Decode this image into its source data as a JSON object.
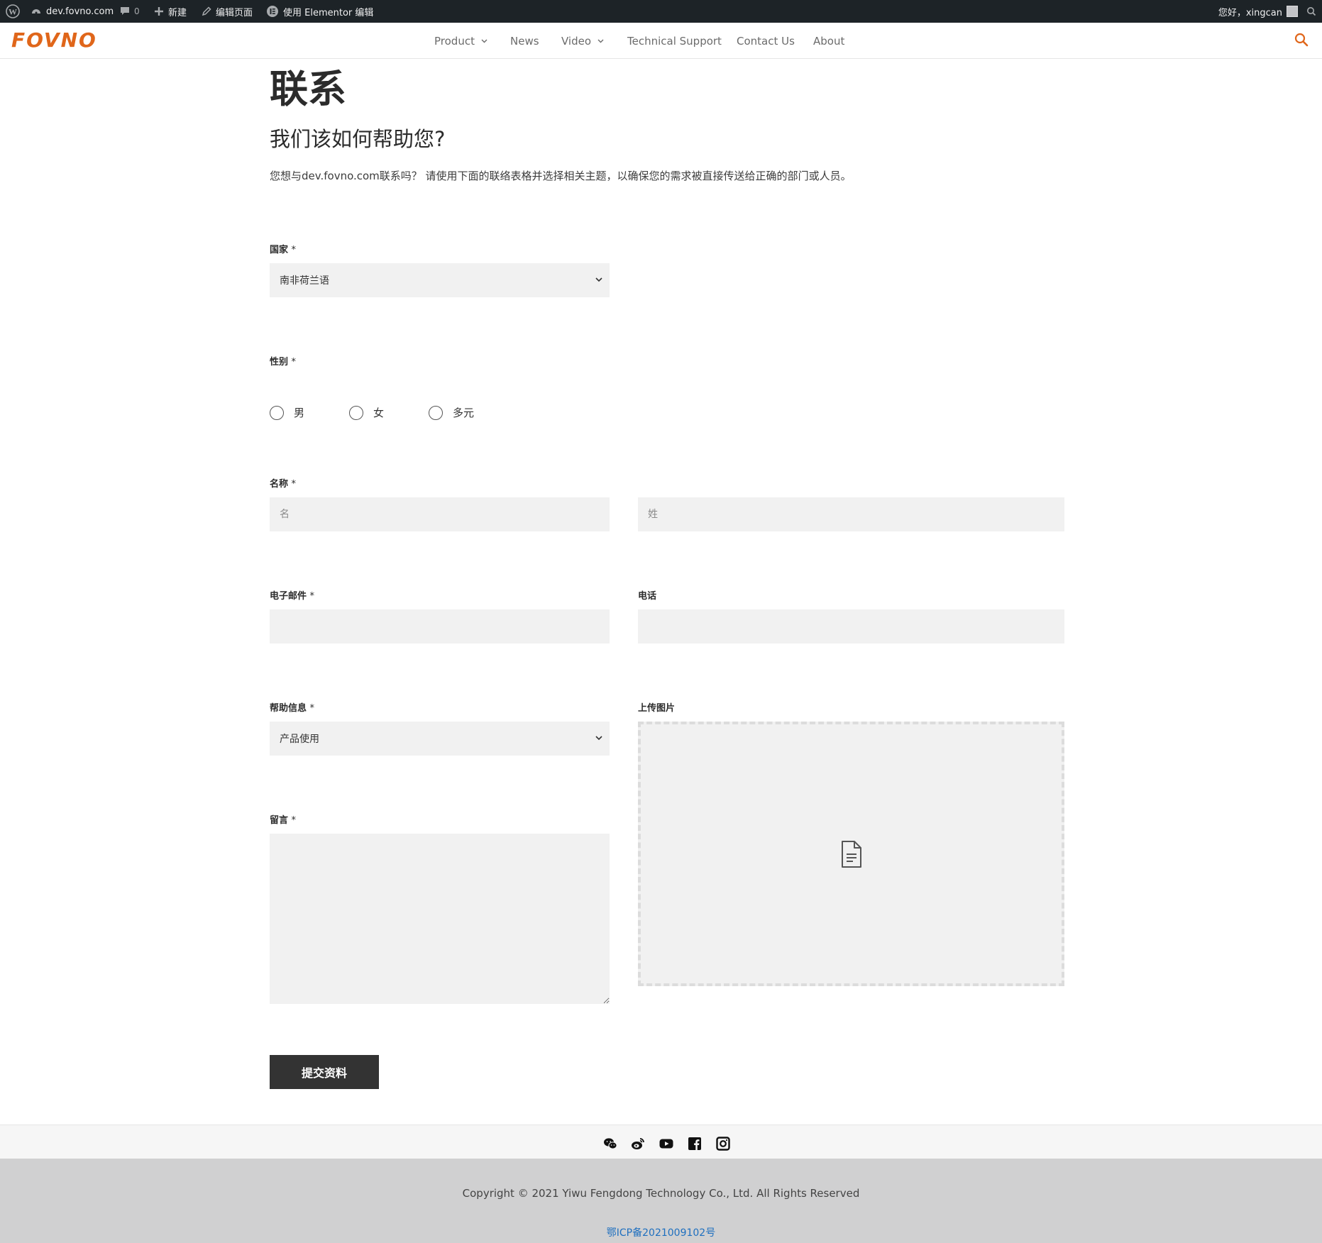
{
  "admin_bar": {
    "site_name": "dev.fovno.com",
    "comments_count": "0",
    "new_label": "新建",
    "edit_page_label": "编辑页面",
    "elementor_label": "使用 Elementor 编辑",
    "greeting": "您好，xingcan"
  },
  "header": {
    "logo_text": "FOVNO",
    "nav": [
      "Product",
      "News",
      "Video",
      "Technical Support",
      "Contact Us",
      "About"
    ]
  },
  "page": {
    "title": "联系",
    "subtitle": "我们该如何帮助您?",
    "intro": "您想与dev.fovno.com联系吗？ 请使用下面的联络表格并选择相关主题，以确保您的需求被直接传送给正确的部门或人员。"
  },
  "form": {
    "country": {
      "label": "国家",
      "required": "*",
      "value": "南非荷兰语"
    },
    "gender": {
      "label": "性别",
      "required": "*",
      "options": [
        "男",
        "女",
        "多元"
      ]
    },
    "name": {
      "label": "名称",
      "required": "*",
      "first_placeholder": "名",
      "last_placeholder": "姓"
    },
    "email": {
      "label": "电子邮件",
      "required": "*"
    },
    "phone": {
      "label": "电话"
    },
    "help": {
      "label": "帮助信息",
      "required": "*",
      "value": "产品使用"
    },
    "upload": {
      "label": "上传图片"
    },
    "message": {
      "label": "留言",
      "required": "*"
    },
    "submit_label": "提交资料"
  },
  "footer": {
    "social": [
      "wechat-icon",
      "weibo-icon",
      "youtube-icon",
      "facebook-icon",
      "instagram-icon"
    ],
    "copyright": "Copyright © 2021 Yiwu Fengdong Technology Co., Ltd. All Rights Reserved",
    "icp": "鄂ICP备2021009102号"
  },
  "colors": {
    "brand": "#e0661a",
    "admin_bar": "#1d2327",
    "button": "#333333",
    "link": "#1e6fbf"
  }
}
